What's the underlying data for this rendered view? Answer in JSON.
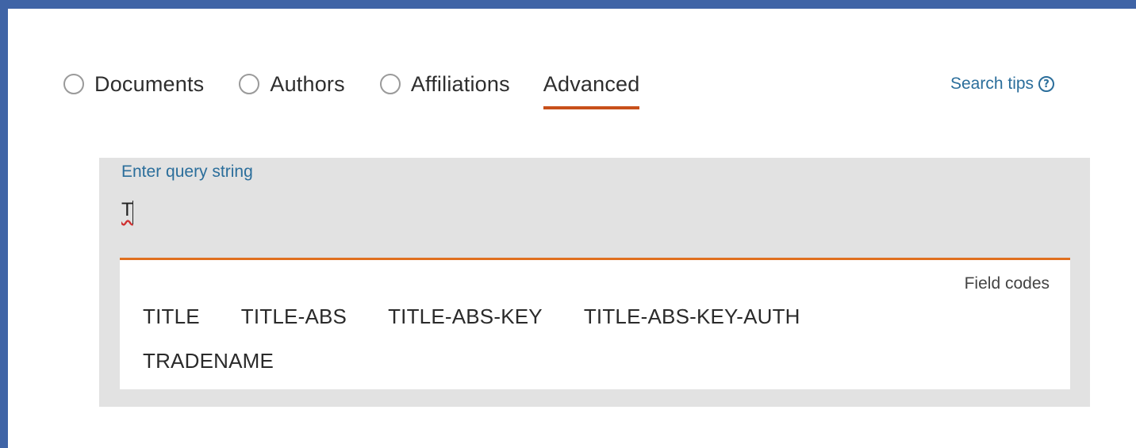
{
  "search_tabs": [
    {
      "label": "Documents",
      "selected": false,
      "has_radio": true
    },
    {
      "label": "Authors",
      "selected": false,
      "has_radio": true
    },
    {
      "label": "Affiliations",
      "selected": false,
      "has_radio": true
    },
    {
      "label": "Advanced",
      "selected": true,
      "has_radio": false
    }
  ],
  "search_tips": {
    "label": "Search tips",
    "icon": "help-circle-icon",
    "icon_glyph": "?"
  },
  "query": {
    "label": "Enter query string",
    "value": "T",
    "placeholder": ""
  },
  "field_codes": {
    "title": "Field codes",
    "row1": [
      "TITLE",
      "TITLE-ABS",
      "TITLE-ABS-KEY",
      "TITLE-ABS-KEY-AUTH"
    ],
    "row2": [
      "TRADENAME"
    ]
  },
  "colors": {
    "frame": "#3f64a6",
    "accent": "#c8501a",
    "link": "#2b6e9b",
    "query_box": "#e2e2e2",
    "divider": "#e0701f"
  }
}
